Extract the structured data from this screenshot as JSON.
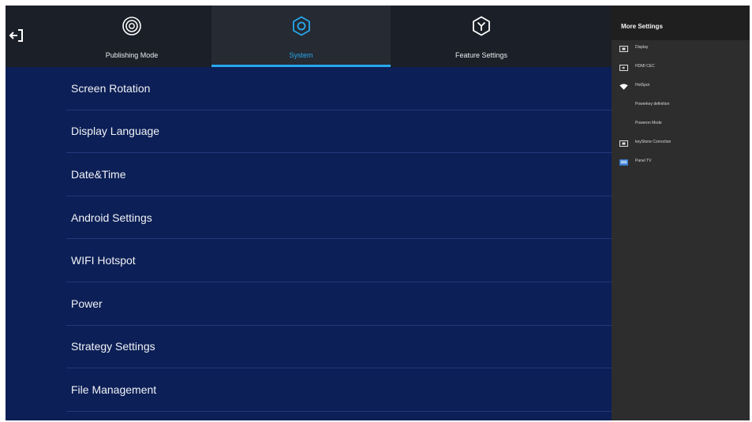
{
  "header": {
    "back_icon": "exit-arrow-icon",
    "tabs": [
      {
        "label": "Publishing Mode",
        "icon": "publishing-ring-icon",
        "active": false
      },
      {
        "label": "System",
        "icon": "gear-icon",
        "active": true
      },
      {
        "label": "Feature Settings",
        "icon": "hexagon-y-icon",
        "active": false
      }
    ]
  },
  "menu": {
    "items": [
      {
        "label": "Screen Rotation"
      },
      {
        "label": "Display Language"
      },
      {
        "label": "Date&Time"
      },
      {
        "label": "Android Settings"
      },
      {
        "label": "WIFI Hotspot"
      },
      {
        "label": "Power"
      },
      {
        "label": "Strategy Settings"
      },
      {
        "label": "File Management"
      }
    ]
  },
  "right_panel": {
    "title": "More Settings",
    "items": [
      {
        "label": "Display",
        "icon": "display-icon"
      },
      {
        "label": "HDMI CEC",
        "icon": "hdmi-icon"
      },
      {
        "label": "HotSpot",
        "icon": "wifi-icon"
      },
      {
        "label": "Powerkey definition",
        "icon": ""
      },
      {
        "label": "Poweron Mode",
        "icon": ""
      },
      {
        "label": "keyStone Correction",
        "icon": "keystone-icon"
      },
      {
        "label": "Panel TV",
        "icon": "panel-tv-icon"
      }
    ]
  },
  "colors": {
    "background": "#0c1f56",
    "header": "#1b1f27",
    "accent": "#27a8ec",
    "side_panel": "#2d2d2d"
  }
}
